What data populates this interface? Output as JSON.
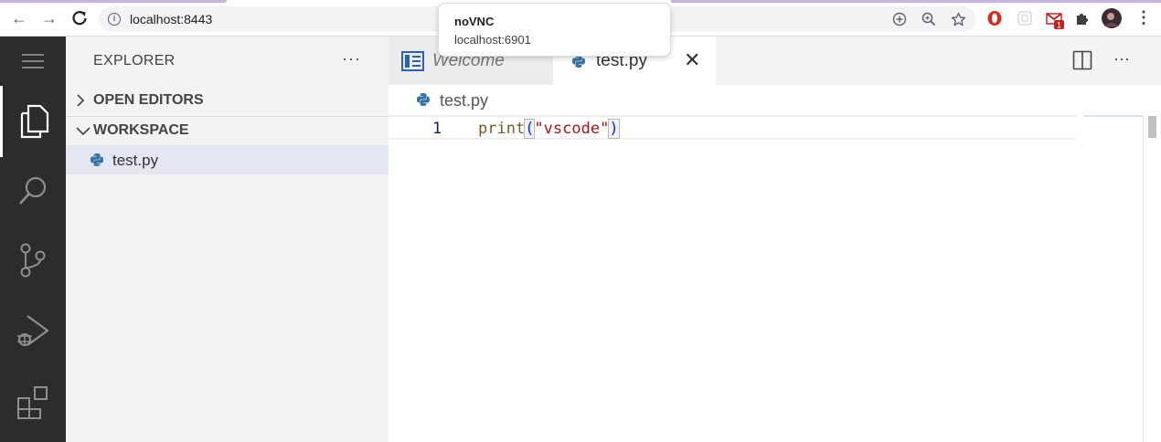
{
  "browser": {
    "url": "localhost:8443",
    "nav": {
      "back_icon": "←",
      "forward_icon": "→",
      "reload_icon": "↻"
    },
    "omnibox_icons": [
      "add-icon",
      "zoom-icon",
      "star-icon"
    ],
    "extensions": [
      "opera-icon",
      "puzzle-grid-icon",
      "gmail-icon",
      "extensions-icon",
      "profile-avatar",
      "menu-icon"
    ],
    "gmail_badge": "1",
    "menu_glyph": "⋮",
    "tooltip": {
      "title": "noVNC",
      "subtitle": "localhost:6901"
    }
  },
  "vscode": {
    "activity_bar": [
      "menu-icon",
      "explorer-icon",
      "search-icon",
      "source-control-icon",
      "run-debug-icon",
      "extensions-icon"
    ],
    "sidebar": {
      "title": "EXPLORER",
      "more": "···",
      "sections": [
        {
          "label": "OPEN EDITORS",
          "chevron": "›",
          "expanded": false
        },
        {
          "label": "WORKSPACE",
          "chevron": "⌄",
          "expanded": true
        }
      ],
      "files": [
        {
          "name": "test.py"
        }
      ]
    },
    "tabs": [
      {
        "label": "Welcome",
        "active": false
      },
      {
        "label": "test.py",
        "active": true,
        "close": "✕"
      }
    ],
    "tab_actions": {
      "split": "▯",
      "more": "···"
    },
    "breadcrumb": "test.py",
    "editor": {
      "lines": [
        {
          "number": "1",
          "fn": "print",
          "open": "(",
          "string": "\"vscode\"",
          "close": ")"
        }
      ]
    }
  }
}
